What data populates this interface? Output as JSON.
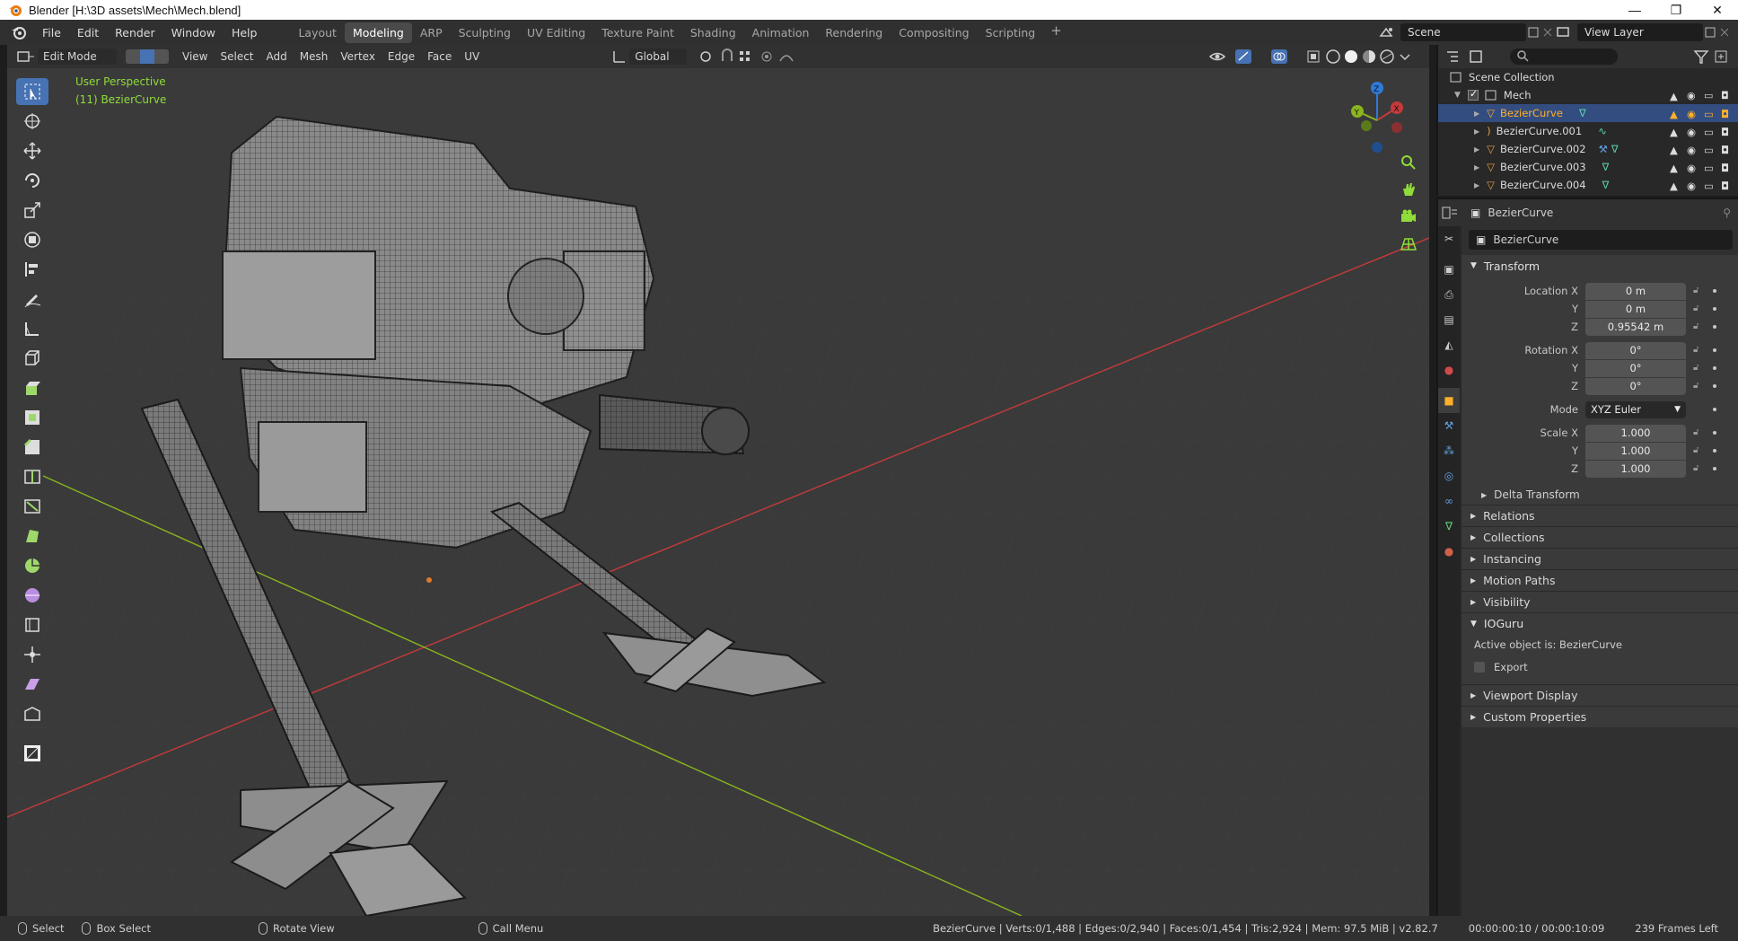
{
  "window": {
    "title": "Blender [H:\\3D assets\\Mech\\Mech.blend]",
    "controls": [
      "—",
      "❐",
      "✕"
    ]
  },
  "menu": [
    "File",
    "Edit",
    "Render",
    "Window",
    "Help"
  ],
  "workspaces": [
    {
      "label": "Layout",
      "active": false
    },
    {
      "label": "Modeling",
      "active": true
    },
    {
      "label": "ARP",
      "active": false
    },
    {
      "label": "Sculpting",
      "active": false
    },
    {
      "label": "UV Editing",
      "active": false
    },
    {
      "label": "Texture Paint",
      "active": false
    },
    {
      "label": "Shading",
      "active": false
    },
    {
      "label": "Animation",
      "active": false
    },
    {
      "label": "Rendering",
      "active": false
    },
    {
      "label": "Compositing",
      "active": false
    },
    {
      "label": "Scripting",
      "active": false
    }
  ],
  "workspace_add": "+",
  "scene": {
    "label": "Scene"
  },
  "view_layer": {
    "label": "View Layer"
  },
  "viewport_header": {
    "mode": "Edit Mode",
    "menus": [
      "View",
      "Select",
      "Add",
      "Mesh",
      "Vertex",
      "Edge",
      "Face",
      "UV"
    ],
    "orientation": "Global"
  },
  "viewport_overlay": {
    "perspective": "User Perspective",
    "object": "(11) BezierCurve"
  },
  "gizmo": {
    "x": "X",
    "y": "Y",
    "z": "Z"
  },
  "outliner": {
    "root": "Scene Collection",
    "collection": "Mech",
    "items": [
      {
        "name": "BezierCurve",
        "selected": true
      },
      {
        "name": "BezierCurve.001",
        "selected": false
      },
      {
        "name": "BezierCurve.002",
        "selected": false
      },
      {
        "name": "BezierCurve.003",
        "selected": false
      },
      {
        "name": "BezierCurve.004",
        "selected": false
      }
    ]
  },
  "properties": {
    "header_object": "BezierCurve",
    "object_name": "BezierCurve",
    "transform": {
      "title": "Transform",
      "location_label": "Location X",
      "location": [
        "0 m",
        "0 m",
        "0.95542 m"
      ],
      "rotation_label": "Rotation X",
      "rotation": [
        "0°",
        "0°",
        "0°"
      ],
      "mode_label": "Mode",
      "mode": "XYZ Euler",
      "scale_label": "Scale X",
      "scale": [
        "1.000",
        "1.000",
        "1.000"
      ],
      "y_label": "Y",
      "z_label": "Z",
      "delta": "Delta Transform"
    },
    "sections": [
      "Relations",
      "Collections",
      "Instancing",
      "Motion Paths",
      "Visibility"
    ],
    "ioguru": {
      "title": "IOGuru",
      "active_text": "Active object is: BezierCurve",
      "export_label": "Export"
    },
    "sections_after": [
      "Viewport Display",
      "Custom Properties"
    ]
  },
  "statusbar": {
    "select": "Select",
    "box_select": "Box Select",
    "rotate": "Rotate View",
    "call_menu": "Call Menu",
    "stats": "BezierCurve | Verts:0/1,488 | Edges:0/2,940 | Faces:0/1,454 | Tris:2,924 | Mem: 97.5 MiB | v2.82.7",
    "time": "00:00:00:10 / 00:00:10:09",
    "frames": "239 Frames Left"
  },
  "colors": {
    "accent": "#4772b3",
    "selection": "#ffaf29",
    "overlay_text": "#8fdc3a",
    "x_axis": "#c53a3a",
    "y_axis": "#8ab51f",
    "z_axis": "#2f79d9"
  }
}
